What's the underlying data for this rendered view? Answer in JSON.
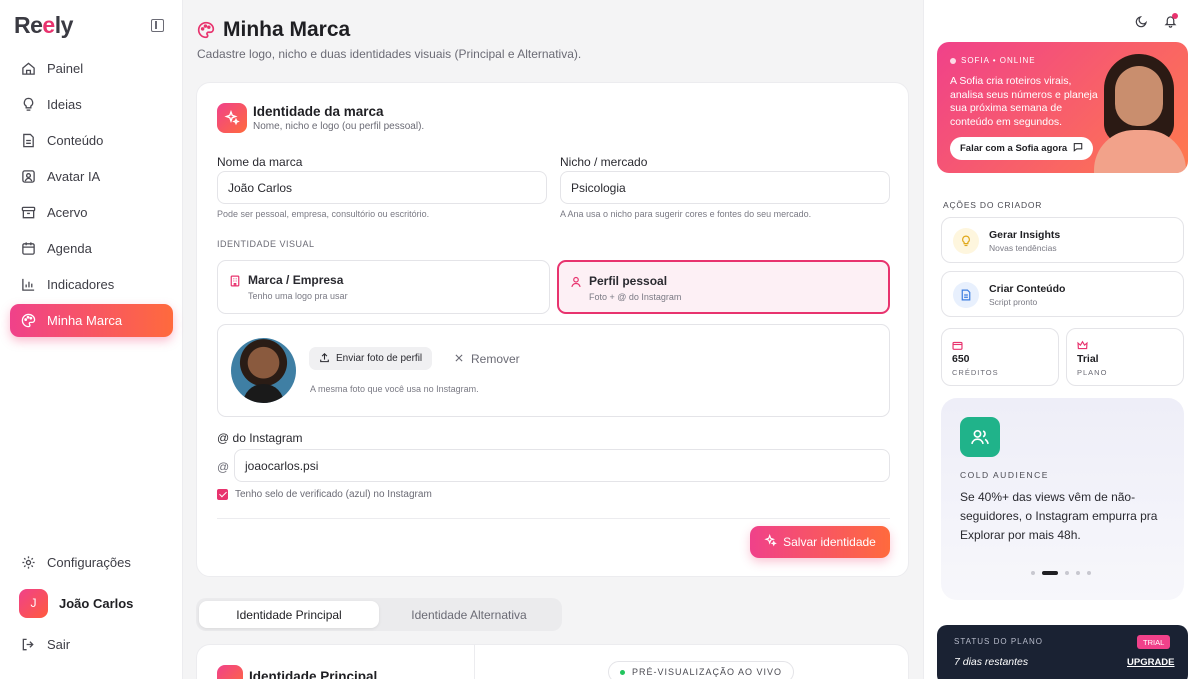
{
  "sidebar": {
    "logo": {
      "prefix": "Re",
      "highlight": "e",
      "suffix": "ly"
    },
    "items": [
      {
        "label": "Painel",
        "icon": "home-icon"
      },
      {
        "label": "Ideias",
        "icon": "lightbulb-icon"
      },
      {
        "label": "Conteúdo",
        "icon": "document-icon"
      },
      {
        "label": "Avatar IA",
        "icon": "avatar-icon"
      },
      {
        "label": "Acervo",
        "icon": "archive-icon"
      },
      {
        "label": "Agenda",
        "icon": "calendar-icon"
      },
      {
        "label": "Indicadores",
        "icon": "bar-chart-icon"
      },
      {
        "label": "Minha Marca",
        "icon": "palette-icon",
        "active": true
      }
    ],
    "settings_label": "Configurações",
    "user": {
      "initial": "J",
      "name": "João Carlos"
    },
    "logout_label": "Sair"
  },
  "header": {
    "title": "Minha Marca",
    "subtitle": "Cadastre logo, nicho e duas identidades visuais (Principal e Alternativa)."
  },
  "brand_card": {
    "title": "Identidade da marca",
    "subtitle": "Nome, nicho e logo (ou perfil pessoal).",
    "name_label": "Nome da marca",
    "name_value": "João Carlos",
    "name_hint": "Pode ser pessoal, empresa, consultório ou escritório.",
    "niche_label": "Nicho / mercado",
    "niche_value": "Psicologia",
    "niche_hint": "A Ana usa o nicho para sugerir cores e fontes do seu mercado.",
    "visual_identity_label": "IDENTIDADE VISUAL",
    "options": [
      {
        "title": "Marca / Empresa",
        "subtitle": "Tenho uma logo pra usar",
        "selected": false
      },
      {
        "title": "Perfil pessoal",
        "subtitle": "Foto + @ do Instagram",
        "selected": true
      }
    ],
    "upload_label": "Enviar foto de perfil",
    "remove_label": "Remover",
    "photo_hint": "A mesma foto que você usa no Instagram.",
    "instagram_label": "@ do Instagram",
    "instagram_prefix": "@",
    "instagram_value": "joaocarlos.psi",
    "verified_label": "Tenho selo de verificado (azul) no Instagram",
    "verified_checked": true,
    "save_label": "Salvar identidade"
  },
  "identity_tabs": [
    {
      "label": "Identidade Principal",
      "active": true
    },
    {
      "label": "Identidade Alternativa",
      "active": false
    }
  ],
  "identity_card": {
    "title": "Identidade Principal",
    "live_preview_label": "PRÉ-VISUALIZAÇÃO AO VIVO"
  },
  "right_panel": {
    "promo": {
      "status": "SOFIA • ONLINE",
      "text": "A Sofia cria roteiros virais, analisa seus números e planeja sua próxima semana de conteúdo em segundos.",
      "cta": "Falar com a Sofia agora"
    },
    "actions_label": "AÇÕES DO CRIADOR",
    "actions": [
      {
        "title": "Gerar Insights",
        "subtitle": "Novas tendências",
        "icon": "lightbulb-icon"
      },
      {
        "title": "Criar Conteúdo",
        "subtitle": "Script pronto",
        "icon": "document-icon"
      }
    ],
    "stats": [
      {
        "value": "650",
        "label": "CRÉDITOS",
        "icon": "wallet-icon"
      },
      {
        "value": "Trial",
        "label": "PLANO",
        "icon": "crown-icon"
      }
    ],
    "insight": {
      "kicker": "COLD AUDIENCE",
      "body": "Se 40%+ das views vêm de não-seguidores, o Instagram empurra pra Explorar por mais 48h.",
      "active_slide": 2,
      "total_slides": 5
    },
    "plan": {
      "status_label": "STATUS DO PLANO",
      "tag": "TRIAL",
      "days_left": "7 dias restantes",
      "upgrade_label": "UPGRADE"
    }
  },
  "colors": {
    "accent_start": "#f0418a",
    "accent_end": "#ff6a3d",
    "accent_pink": "#e8336e",
    "insight_icon_bg": "#20b38a",
    "plan_bg": "#1a2233"
  }
}
